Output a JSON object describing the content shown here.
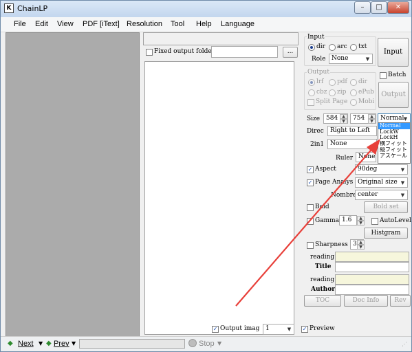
{
  "window": {
    "title": "ChainLP",
    "app_icon": "K",
    "min": "–",
    "max": "□",
    "close": "✕"
  },
  "menu": [
    "File",
    "Edit",
    "View",
    "PDF [iText]",
    "Resolution",
    "Tool",
    "Help",
    "Language"
  ],
  "top": {
    "fixed_output_folder": "Fixed output folde",
    "folder_value": "",
    "browse": "..."
  },
  "input": {
    "group": "Input",
    "dir": "dir",
    "arc": "arc",
    "txt": "txt",
    "role_label": "Role",
    "role_value": "None",
    "input_button": "Input",
    "selected": "dir"
  },
  "output": {
    "group": "Output",
    "lrf": "lrf",
    "pdf": "pdf",
    "dir": "dir",
    "cbz": "cbz",
    "zip": "zip",
    "epub": "ePub",
    "split_page": "Split Page",
    "mobi": "Mobi",
    "batch": "Batch",
    "output_button": "Output"
  },
  "size": {
    "label": "Size",
    "width": "584",
    "height": "754",
    "mode": "Normal",
    "options": [
      "Normal",
      "LockW",
      "LockH",
      "横フィット",
      "縦フィット",
      "アスケール"
    ],
    "selected_index": 0
  },
  "direc": {
    "label": "Direc",
    "value": "Right to Left"
  },
  "twoin1": {
    "label": "2in1",
    "value": "None"
  },
  "ruler": {
    "label": "Ruler",
    "value": "None"
  },
  "aspect": {
    "label": "Aspect",
    "value": "90deg",
    "checked": true
  },
  "page_analysis": {
    "label": "Page Analys",
    "value": "Original size",
    "checked": true
  },
  "nombre": {
    "label": "Nombre",
    "value": "center"
  },
  "bold": {
    "label": "Bold",
    "button": "Bold set",
    "checked": false
  },
  "gamma": {
    "label": "Gamma",
    "value": "1.6",
    "autolevel": "AutoLevel",
    "histgram": "Histgram",
    "checked": false
  },
  "sharpness": {
    "label": "Sharpness",
    "value": "3",
    "checked": false
  },
  "meta": {
    "reading1": "reading",
    "title": "Title",
    "reading2": "reading",
    "author": "Author",
    "title_value": "",
    "author_value": ""
  },
  "bottom_buttons": {
    "toc": "TOC",
    "doc_info": "Doc Info",
    "rev": "Rev"
  },
  "output_image": {
    "label": "Output imag",
    "value": "1",
    "checked": true
  },
  "preview": {
    "label": "Preview",
    "checked": true
  },
  "status": {
    "next": "Next",
    "prev": "Prev",
    "stop": "Stop",
    "progress": 0
  }
}
